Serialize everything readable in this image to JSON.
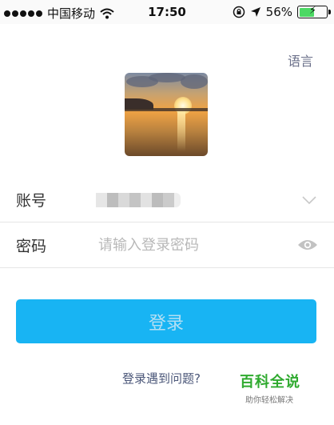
{
  "status_bar": {
    "carrier": "中国移动",
    "time": "17:50",
    "battery_percent": "56%",
    "battery_level": 0.56,
    "battery_color": "#4cd964"
  },
  "header": {
    "language_label": "语言"
  },
  "avatar": {
    "icon": "sunset-photo"
  },
  "form": {
    "account_label": "账号",
    "password_label": "密码",
    "password_placeholder": "请输入登录密码",
    "dropdown_icon": "chevron-down-icon",
    "eye_icon": "eye-icon"
  },
  "login_button": {
    "label": "登录",
    "color": "#18b4f3"
  },
  "help_link": "登录遇到问题?",
  "watermark": {
    "title": "百科全说",
    "subtitle": "助你轻松解决",
    "color": "#2faa2f"
  }
}
